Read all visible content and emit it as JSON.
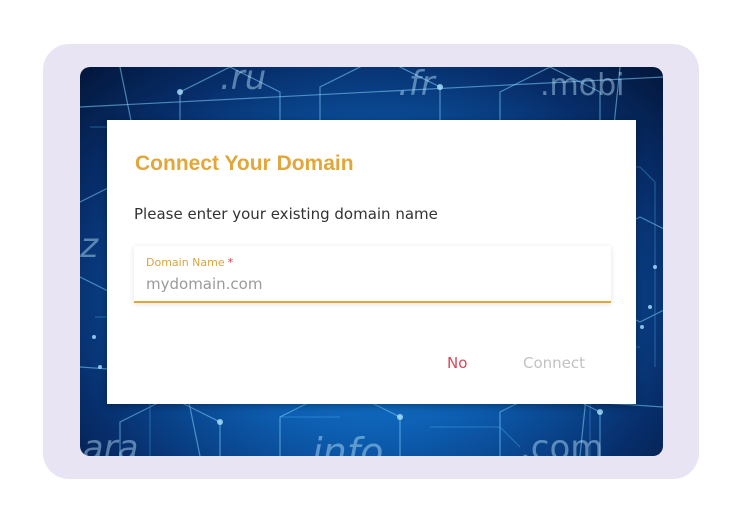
{
  "background": {
    "tld_labels": [
      ".ru",
      ".fr",
      ".mobi",
      ".iz",
      ".ara",
      ".info",
      ".com"
    ]
  },
  "dialog": {
    "title": "Connect Your Domain",
    "description": "Please enter your existing domain name",
    "field": {
      "label": "Domain Name",
      "required_mark": "*",
      "placeholder": "mydomain.com",
      "value": ""
    },
    "actions": {
      "no_label": "No",
      "connect_label": "Connect"
    }
  },
  "colors": {
    "accent": "#e3a63a",
    "danger": "#d9475a",
    "disabled": "#c2c2c2",
    "frame": "#e8e4f3"
  }
}
